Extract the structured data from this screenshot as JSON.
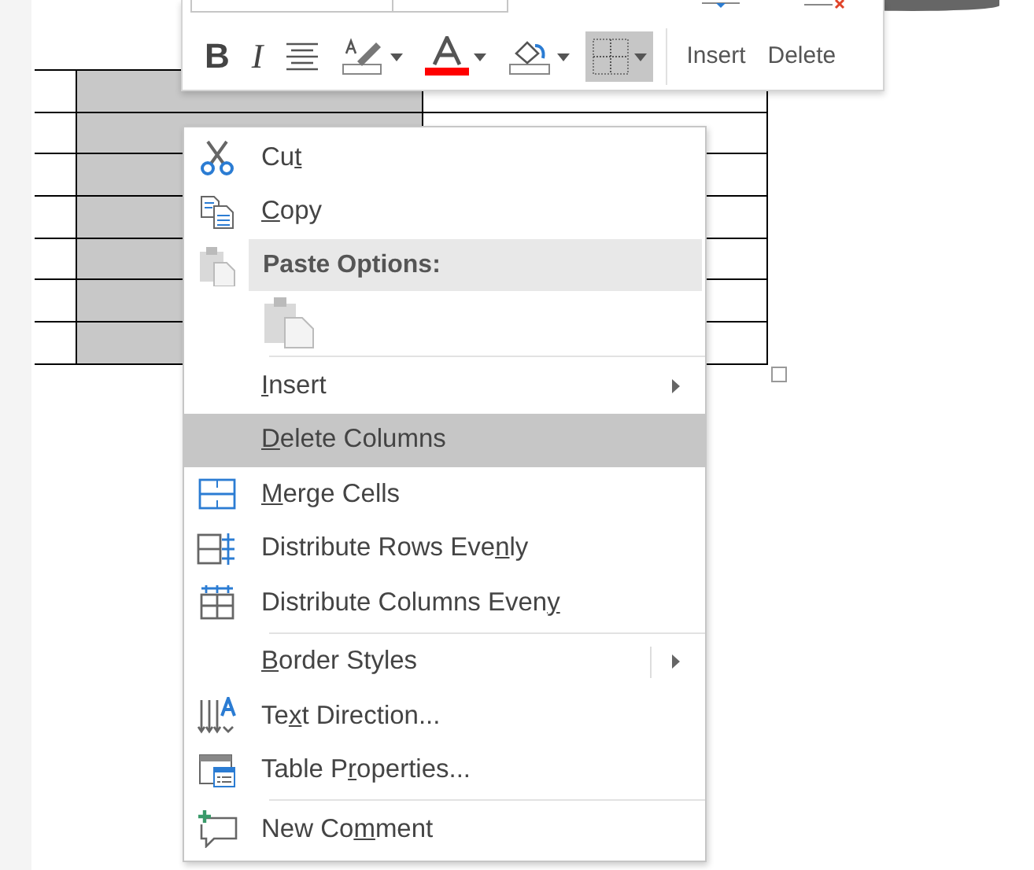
{
  "table": {
    "columns": [
      {
        "selected": false
      },
      {
        "selected": true
      },
      {
        "selected": false
      }
    ]
  },
  "mini_toolbar": {
    "tools": [
      {
        "kind": "bold",
        "label": "B",
        "dropdown": false,
        "selected": false
      },
      {
        "kind": "italic",
        "label": "I",
        "dropdown": false,
        "selected": false
      },
      {
        "kind": "align",
        "dropdown": false,
        "selected": false
      },
      {
        "kind": "highlight",
        "dropdown": true,
        "selected": false
      },
      {
        "kind": "font-color",
        "dropdown": true,
        "selected": false
      },
      {
        "kind": "shading",
        "dropdown": true,
        "selected": false
      },
      {
        "kind": "borders",
        "dropdown": true,
        "selected": true
      }
    ],
    "actions": [
      {
        "label": "Insert"
      },
      {
        "label": "Delete"
      }
    ]
  },
  "context_menu": {
    "items": [
      {
        "kind": "command",
        "pre": "Cu",
        "key": "t",
        "selected": false,
        "submenu": false
      },
      {
        "kind": "command",
        "key": "C",
        "post": "opy",
        "selected": false,
        "submenu": false
      },
      {
        "kind": "header",
        "label": "Paste Options:"
      },
      {
        "kind": "paste-option"
      },
      {
        "kind": "separator"
      },
      {
        "kind": "command",
        "key": "I",
        "post": "nsert",
        "selected": false,
        "submenu": true
      },
      {
        "kind": "command",
        "key": "D",
        "post": "elete Columns",
        "selected": true,
        "submenu": false
      },
      {
        "kind": "command",
        "key": "M",
        "post": "erge Cells",
        "selected": false,
        "submenu": false
      },
      {
        "kind": "command",
        "pre": "Distribute Rows Eve",
        "key": "n",
        "post": "ly",
        "selected": false,
        "submenu": false
      },
      {
        "kind": "command",
        "pre": "Distribute Columns Even",
        "key": "y",
        "selected": false,
        "submenu": false
      },
      {
        "kind": "separator"
      },
      {
        "kind": "command",
        "key": "B",
        "post": "order Styles",
        "selected": false,
        "submenu": true,
        "split": true
      },
      {
        "kind": "command",
        "pre": "Te",
        "key": "x",
        "post": "t Direction...",
        "selected": false,
        "submenu": false
      },
      {
        "kind": "command",
        "pre": "Table P",
        "key": "r",
        "post": "operties...",
        "selected": false,
        "submenu": false
      },
      {
        "kind": "separator"
      },
      {
        "kind": "command",
        "pre": "New Co",
        "key": "m",
        "post": "ment",
        "selected": false,
        "submenu": false
      }
    ]
  }
}
